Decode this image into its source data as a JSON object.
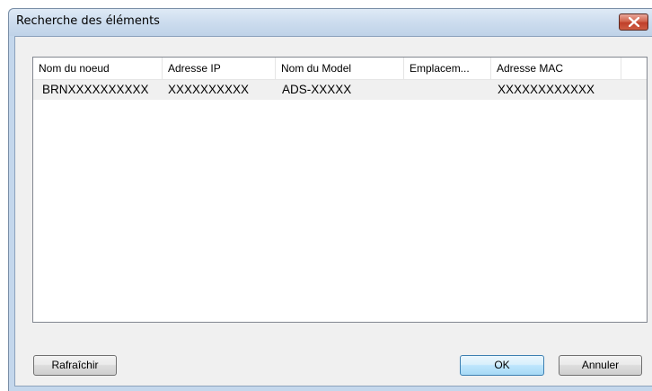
{
  "window": {
    "title": "Recherche des éléments"
  },
  "list": {
    "columns": [
      "Nom du noeud",
      "Adresse IP",
      "Nom du Model",
      "Emplacem...",
      "Adresse MAC"
    ],
    "rows": [
      {
        "node_name": "BRNXXXXXXXXXX",
        "ip_address": "XXXXXXXXXX",
        "model_name": "ADS-XXXXX",
        "location": "",
        "mac_address": "XXXXXXXXXXXX"
      }
    ]
  },
  "buttons": {
    "refresh_label": "Rafraîchir",
    "ok_label": "OK",
    "cancel_label": "Annuler"
  },
  "colors": {
    "titlebar": "#ccdcee",
    "close_button": "#c0402a",
    "selected_row": "#f0f0f0",
    "default_button_border": "#3c7fb1"
  },
  "icons": {
    "close": "close-icon"
  }
}
